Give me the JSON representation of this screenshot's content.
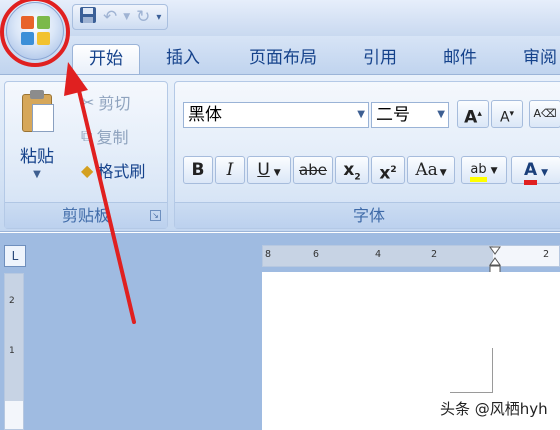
{
  "tabs": [
    "开始",
    "插入",
    "页面布局",
    "引用",
    "邮件",
    "审阅"
  ],
  "clipboard": {
    "paste_label": "粘贴",
    "cut_label": "剪切",
    "copy_label": "复制",
    "format_painter_label": "格式刷",
    "group_label": "剪贴板"
  },
  "font": {
    "font_name": "黑体",
    "font_size": "二号",
    "bold": "B",
    "italic": "I",
    "underline": "U",
    "strikethrough": "abe",
    "subscript": "x",
    "subscript_mark": "2",
    "superscript": "x",
    "superscript_mark": "2",
    "change_case": "Aa",
    "grow_font": "A",
    "shrink_font": "A",
    "highlight": "ab",
    "font_color": "A",
    "group_label": "字体"
  },
  "ruler": {
    "ticks": [
      "8",
      "6",
      "4",
      "2",
      "2"
    ],
    "vertical_marks": [
      "2",
      "1"
    ],
    "corner_glyph": "L"
  },
  "watermark": "头条 @风栖hyh",
  "colors": {
    "annotation": "#e02020",
    "ribbon_text": "#15428b",
    "highlight": "#ffff00",
    "font_color_bar": "#e02020"
  },
  "icons": {
    "office_button": "office-logo-icon",
    "save": "save-icon",
    "undo": "undo-icon",
    "redo": "redo-icon",
    "customize": "qat-dropdown-icon",
    "cut": "scissors-icon",
    "copy": "copy-icon",
    "format_painter": "brush-icon"
  }
}
